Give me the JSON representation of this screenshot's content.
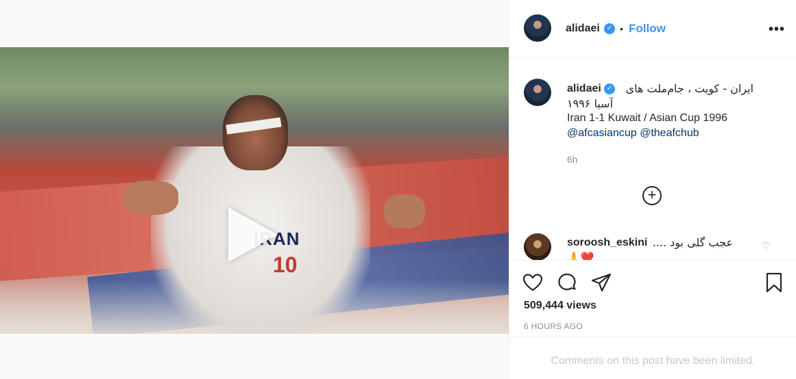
{
  "post": {
    "username": "alidaei",
    "follow_label": "Follow",
    "dot": "•",
    "more": "•••"
  },
  "caption": {
    "username": "alidaei",
    "line_fa_1": "ایران - کویت ، جام‌ملت های",
    "line_fa_2": "آسیا ۱۹۹۶",
    "line_en": "Iran 1-1 Kuwait / Asian Cup 1996",
    "mentions": [
      "@afcasiancup",
      "@theafchub"
    ],
    "time": "6h",
    "load_more": "+"
  },
  "comment": {
    "username": "soroosh_eskini",
    "text": "عجب گلی بود ....",
    "line2": "🙏❤️"
  },
  "stats": {
    "views": "509,444 views",
    "time_ago": "6 HOURS AGO"
  },
  "footer": {
    "limited": "Comments on this post have been limited."
  },
  "video": {
    "jersey_text": "IRAN",
    "jersey_number": "10"
  },
  "colors": {
    "accent": "#3897f0",
    "link": "#00376b",
    "muted": "#8e8e8e"
  },
  "icons": [
    "verified-badge-icon",
    "more-options-icon",
    "play-icon",
    "add-circle-icon",
    "heart-icon",
    "comment-icon",
    "share-icon",
    "bookmark-icon"
  ]
}
